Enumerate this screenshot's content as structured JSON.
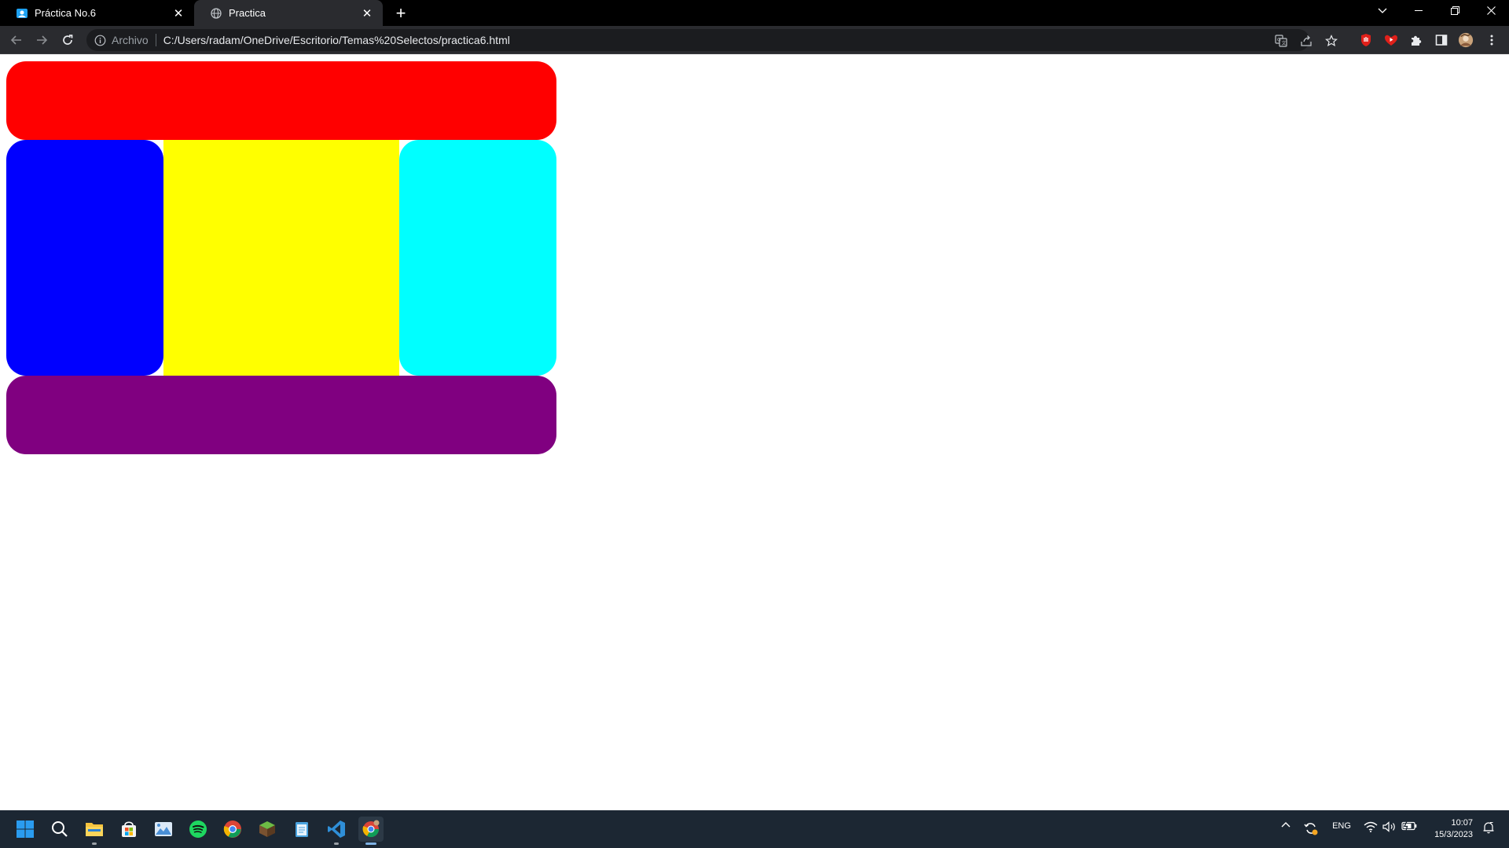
{
  "browser": {
    "tabs": [
      {
        "title": "Práctica No.6",
        "active": false
      },
      {
        "title": "Practica",
        "active": true
      }
    ],
    "omnibox": {
      "scheme_label": "Archivo",
      "url": "C:/Users/radam/OneDrive/Escritorio/Temas%20Selectos/practica6.html"
    }
  },
  "page": {
    "blocks": [
      {
        "name": "header",
        "color": "#ff0000"
      },
      {
        "name": "left",
        "color": "#0000ff"
      },
      {
        "name": "center",
        "color": "#ffff00"
      },
      {
        "name": "right",
        "color": "#00ffff"
      },
      {
        "name": "footer",
        "color": "#800080"
      }
    ]
  },
  "taskbar": {
    "apps": [
      "start",
      "search",
      "file-explorer",
      "microsoft-store",
      "photos",
      "spotify",
      "chrome",
      "minecraft",
      "notepad",
      "vscode",
      "chrome-dev"
    ],
    "tray": {
      "language": "ENG",
      "time": "10:07",
      "date": "15/3/2023"
    }
  }
}
